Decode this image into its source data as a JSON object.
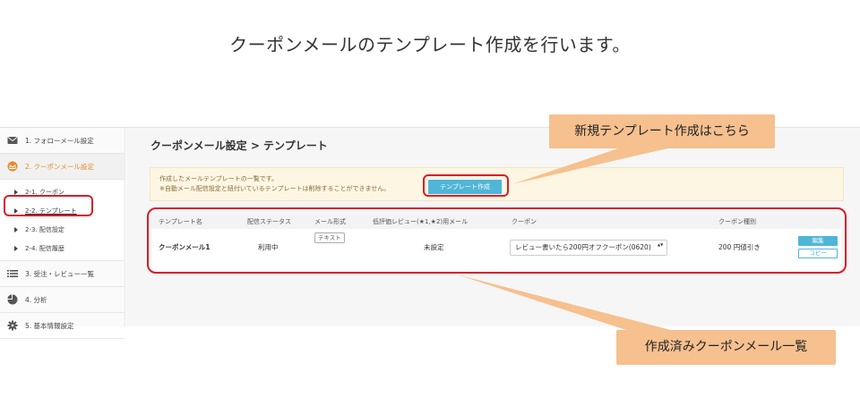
{
  "heading": "クーポンメールのテンプレート作成を行います。",
  "sidebar": {
    "items": [
      {
        "label": "1. フォローメール設定",
        "icon": "envelope-icon"
      },
      {
        "label": "2. クーポンメール設定",
        "icon": "coupon-mail-icon"
      },
      {
        "label": "3. 受注・レビュー一覧",
        "icon": "list-icon"
      },
      {
        "label": "4. 分析",
        "icon": "pie-chart-icon"
      },
      {
        "label": "5. 基本情報設定",
        "icon": "gear-icon"
      }
    ],
    "subitems": [
      "2-1. クーポン",
      "2-2. テンプレート",
      "2-3. 配信設定",
      "2-4. 配信履歴"
    ]
  },
  "main": {
    "breadcrumb": "クーポンメール設定 > テンプレート",
    "notice_line1": "作成したメールテンプレートの一覧です。",
    "notice_line2": "※自動メール配信設定と紐付いているテンプレートは削除することができません。",
    "create_button": "テンプレート作成",
    "table": {
      "headers": [
        "テンプレート名",
        "配信ステータス",
        "メール形式",
        "低評価レビュー(★1,★2)用メール",
        "クーポン",
        "クーポン種別"
      ],
      "rows": [
        {
          "name": "クーポンメール1",
          "status": "利用中",
          "format": "テキスト",
          "low_review": "未設定",
          "coupon": "レビュー書いたら200円オフクーポン(0620)",
          "coupon_type": "200 円値引き",
          "edit_label": "編集",
          "copy_label": "コピー"
        }
      ]
    }
  },
  "annotations": {
    "callout_top": "新規テンプレート作成はこちら",
    "callout_bottom": "作成済みクーポンメール一覧"
  },
  "colors": {
    "accent": "#4fb6d8",
    "highlight": "#d91c2a",
    "callout": "#f6c08f",
    "active_nav": "#e8892e"
  }
}
